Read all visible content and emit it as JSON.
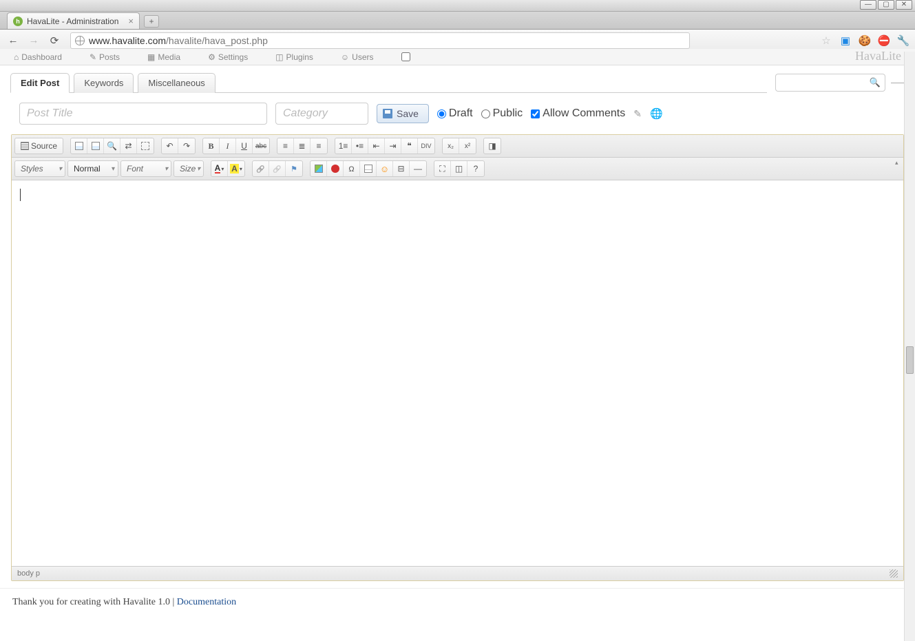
{
  "window": {
    "title": "HavaLite - Administration"
  },
  "browser": {
    "url_host": "www.havalite.com",
    "url_path": "/havalite/hava_post.php"
  },
  "admin_nav": {
    "items": [
      "Dashboard",
      "Posts",
      "Media",
      "Settings",
      "Plugins",
      "Users"
    ],
    "brand": "HavaLite"
  },
  "inner_tabs": {
    "items": [
      {
        "label": "Edit Post",
        "active": true
      },
      {
        "label": "Keywords",
        "active": false
      },
      {
        "label": "Miscellaneous",
        "active": false
      }
    ]
  },
  "form": {
    "title_placeholder": "Post Title",
    "title_value": "",
    "category_placeholder": "Category",
    "category_value": "",
    "save_label": "Save",
    "draft_label": "Draft",
    "public_label": "Public",
    "allow_comments_label": "Allow Comments",
    "draft_checked": true,
    "public_checked": false,
    "allow_comments_checked": true
  },
  "editor": {
    "source_label": "Source",
    "styles_label": "Styles",
    "format_label": "Normal",
    "font_label": "Font",
    "size_label": "Size",
    "status_path": "body  p",
    "content": ""
  },
  "footer": {
    "text_prefix": "Thank you for creating with Havalite 1.0 | ",
    "doc_label": "Documentation"
  }
}
